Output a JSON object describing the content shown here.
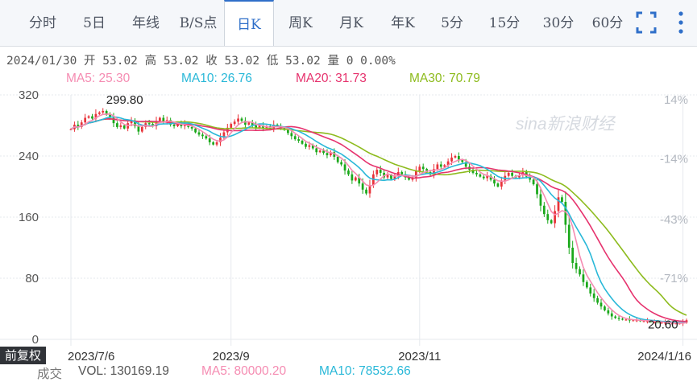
{
  "tabs": [
    {
      "label": "分时",
      "active": false
    },
    {
      "label": "5日",
      "active": false
    },
    {
      "label": "年线",
      "active": false
    },
    {
      "label": "B/S点",
      "active": false
    },
    {
      "label": "日K",
      "active": true
    },
    {
      "label": "周K",
      "active": false
    },
    {
      "label": "月K",
      "active": false
    },
    {
      "label": "年K",
      "active": false
    },
    {
      "label": "5分",
      "active": false
    },
    {
      "label": "15分",
      "active": false
    },
    {
      "label": "30分",
      "active": false
    },
    {
      "label": "60分",
      "active": false
    }
  ],
  "icons": {
    "fullscreen": "fullscreen-icon",
    "more": "more-vertical-icon"
  },
  "info_line": "2024/01/30 开 53.02 高 53.02 收 53.02 低 53.02 量 0 0.00%",
  "ma": {
    "ma5": "MA5: 25.30",
    "ma10": "MA10: 26.76",
    "ma20": "MA20: 31.73",
    "ma30": "MA30: 70.79"
  },
  "volume": {
    "label": "成交",
    "vol": "VOL: 130169.19",
    "ma5": "MA5: 80000.20",
    "ma10": "MA10: 78532.66"
  },
  "adjust_button": "前复权",
  "watermark": "sina新浪财经",
  "colors": {
    "up": "#e8333a",
    "down": "#1aa81a",
    "ma5": "#f58cb2",
    "ma10": "#29b8d8",
    "ma20": "#e6336e",
    "ma30": "#8dbb1d",
    "accent": "#2f6fc9"
  },
  "chart_data": {
    "type": "candlestick",
    "y_ticks": [
      320,
      240,
      160,
      80,
      0
    ],
    "ylim": [
      0,
      320
    ],
    "pct_ticks": [
      "14%",
      "-14%",
      "-43%",
      "-71%"
    ],
    "pct_values": [
      14,
      -14,
      -43,
      -71
    ],
    "x_ticks": [
      "2023/7/6",
      "2023/9",
      "2023/11",
      "2024/1/16"
    ],
    "x_tick_index": [
      0,
      45,
      98,
      172
    ],
    "max_label": "299.80",
    "max_index": 9,
    "max_value": 299.8,
    "min_label": "20.60",
    "min_index": 172,
    "min_value": 20.6,
    "close": [
      275,
      281,
      278,
      284,
      290,
      292,
      289,
      295,
      297,
      299,
      294,
      290,
      283,
      278,
      280,
      276,
      283,
      286,
      279,
      272,
      278,
      283,
      282,
      279,
      286,
      290,
      285,
      287,
      281,
      279,
      283,
      279,
      282,
      278,
      276,
      271,
      268,
      266,
      263,
      258,
      255,
      258,
      264,
      271,
      277,
      282,
      285,
      289,
      286,
      281,
      284,
      280,
      277,
      280,
      276,
      279,
      276,
      281,
      279,
      277,
      274,
      270,
      266,
      262,
      260,
      256,
      252,
      254,
      250,
      245,
      247,
      244,
      241,
      245,
      239,
      232,
      229,
      221,
      216,
      208,
      212,
      204,
      196,
      191,
      202,
      216,
      222,
      218,
      212,
      215,
      210,
      214,
      219,
      216,
      212,
      209,
      212,
      220,
      226,
      223,
      219,
      216,
      223,
      229,
      226,
      228,
      233,
      238,
      240,
      235,
      232,
      226,
      222,
      218,
      216,
      213,
      211,
      214,
      209,
      204,
      200,
      208,
      214,
      218,
      214,
      212,
      215,
      219,
      213,
      209,
      203,
      190,
      175,
      164,
      156,
      152,
      168,
      186,
      180,
      150,
      120,
      100,
      92,
      85,
      75,
      68,
      60,
      54,
      48,
      43,
      38,
      34,
      30,
      28,
      27,
      26,
      26,
      25,
      25,
      25,
      24,
      24,
      24,
      23,
      23,
      22,
      22,
      22,
      21,
      21,
      21,
      21,
      22,
      25
    ]
  }
}
